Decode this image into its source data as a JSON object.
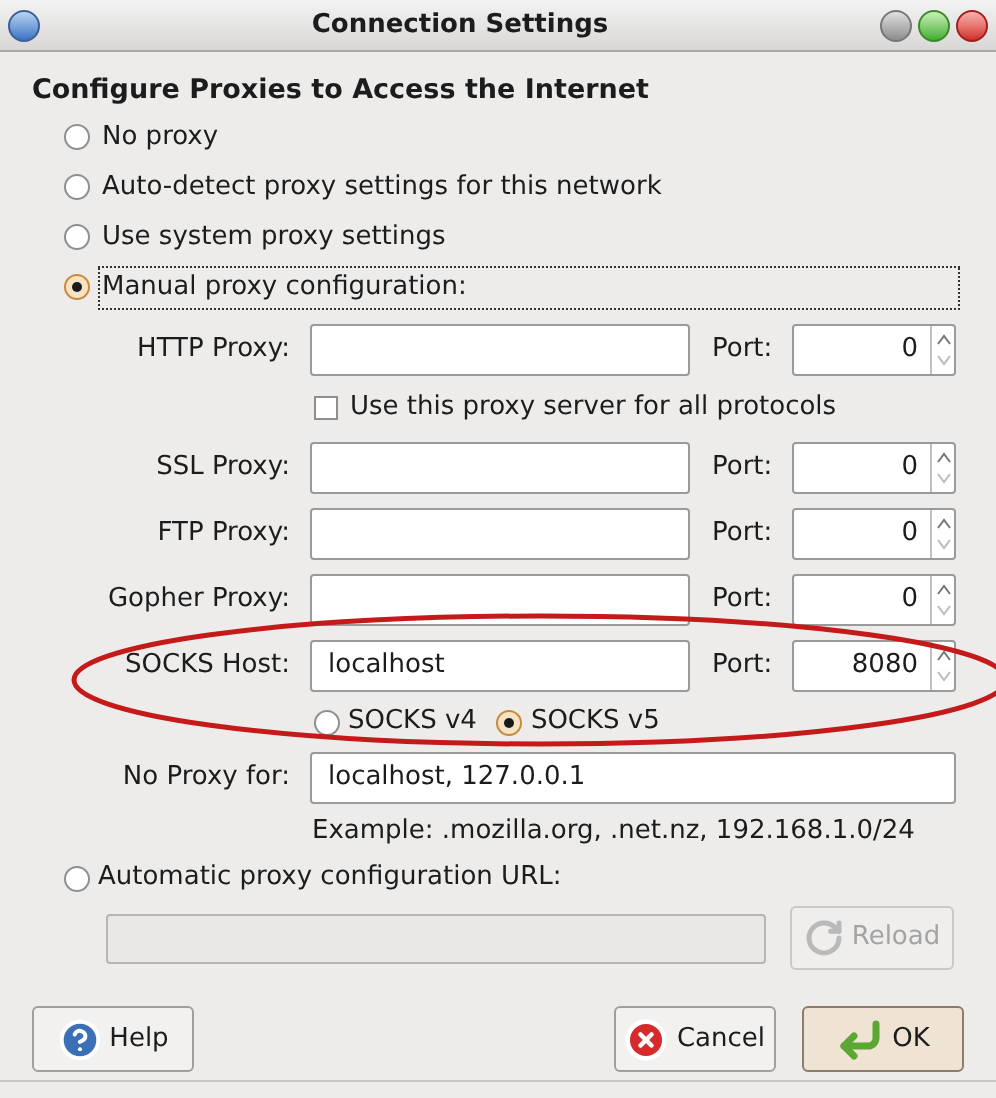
{
  "window": {
    "title": "Connection Settings"
  },
  "heading": "Configure Proxies to Access the Internet",
  "proxy_modes": [
    {
      "label": "No proxy",
      "selected": false,
      "focused": false
    },
    {
      "label": "Auto-detect proxy settings for this network",
      "selected": false,
      "focused": false
    },
    {
      "label": "Use system proxy settings",
      "selected": false,
      "focused": false
    },
    {
      "label": "Manual proxy configuration:",
      "selected": true,
      "focused": true
    }
  ],
  "manual_rows": [
    {
      "kind": "proxy",
      "label": "HTTP Proxy:",
      "port_label": "Port:",
      "port": "0"
    },
    {
      "kind": "checkbox",
      "label": "Use this proxy server for all protocols",
      "checked": false
    },
    {
      "kind": "proxy",
      "label": "SSL Proxy:",
      "port_label": "Port:",
      "port": "0"
    },
    {
      "kind": "proxy",
      "label": "FTP Proxy:",
      "port_label": "Port:",
      "port": "0"
    },
    {
      "kind": "proxy",
      "label": "Gopher Proxy:",
      "port_label": "Port:",
      "port": "0"
    },
    {
      "kind": "proxy",
      "label": "SOCKS Host:",
      "value": "localhost",
      "port_label": "Port:",
      "port": "8080"
    },
    {
      "kind": "radios",
      "options": [
        {
          "label": "SOCKS v4",
          "selected": false
        },
        {
          "label": "SOCKS v5",
          "selected": true
        }
      ]
    }
  ],
  "no_proxy": {
    "label": "No Proxy for:",
    "value": "localhost, 127.0.0.1",
    "example": "Example: .mozilla.org, .net.nz, 192.168.1.0/24"
  },
  "auto_url": {
    "label": "Automatic proxy configuration URL:",
    "selected": false,
    "disabled": true
  },
  "reload_button": {
    "label": "Reload",
    "disabled": true
  },
  "buttons": [
    {
      "label": "Help",
      "kind": "help"
    },
    {
      "label": "Cancel",
      "kind": "cancel"
    },
    {
      "label": "OK",
      "kind": "ok"
    }
  ]
}
